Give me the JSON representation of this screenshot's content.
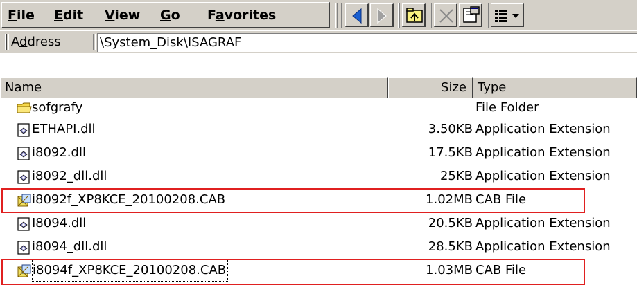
{
  "menu": {
    "file": {
      "mnemonic": "F",
      "rest": "ile"
    },
    "edit": {
      "mnemonic": "E",
      "rest": "dit"
    },
    "view": {
      "mnemonic": "V",
      "rest": "iew"
    },
    "go": {
      "mnemonic": "G",
      "rest": "o"
    },
    "favorites": {
      "pre": "F",
      "mnemonic": "a",
      "rest": "vorites"
    }
  },
  "toolbar_icons": [
    "back-arrow-icon",
    "forward-arrow-icon",
    "up-folder-icon",
    "delete-icon",
    "properties-icon",
    "views-icon"
  ],
  "address": {
    "label_pre": "A",
    "label_mnemonic": "d",
    "label_rest": "dress",
    "value": "\\System_Disk\\ISAGRAF"
  },
  "columns": {
    "name": "Name",
    "size": "Size",
    "type": "Type"
  },
  "files": [
    {
      "name": "sofgrafy",
      "size": "",
      "type": "File Folder",
      "icon": "folder-icon"
    },
    {
      "name": "ETHAPI.dll",
      "size": "3.50KB",
      "type": "Application Extension",
      "icon": "dll-file-icon"
    },
    {
      "name": "i8092.dll",
      "size": "17.5KB",
      "type": "Application Extension",
      "icon": "dll-file-icon"
    },
    {
      "name": "i8092_dll.dll",
      "size": "25KB",
      "type": "Application Extension",
      "icon": "dll-file-icon"
    },
    {
      "name": "i8092f_XP8KCE_20100208.CAB",
      "size": "1.02MB",
      "type": "CAB File",
      "icon": "cab-file-icon"
    },
    {
      "name": "I8094.dll",
      "size": "20.5KB",
      "type": "Application Extension",
      "icon": "dll-file-icon"
    },
    {
      "name": "i8094_dll.dll",
      "size": "28.5KB",
      "type": "Application Extension",
      "icon": "dll-file-icon"
    },
    {
      "name": "i8094f_XP8KCE_20100208.CAB",
      "size": "1.03MB",
      "type": "CAB File",
      "icon": "cab-file-icon"
    }
  ],
  "colors": {
    "chrome": "#d4d0c8",
    "highlight_box": "#e02020",
    "back_arrow": "#1a5fd0"
  }
}
